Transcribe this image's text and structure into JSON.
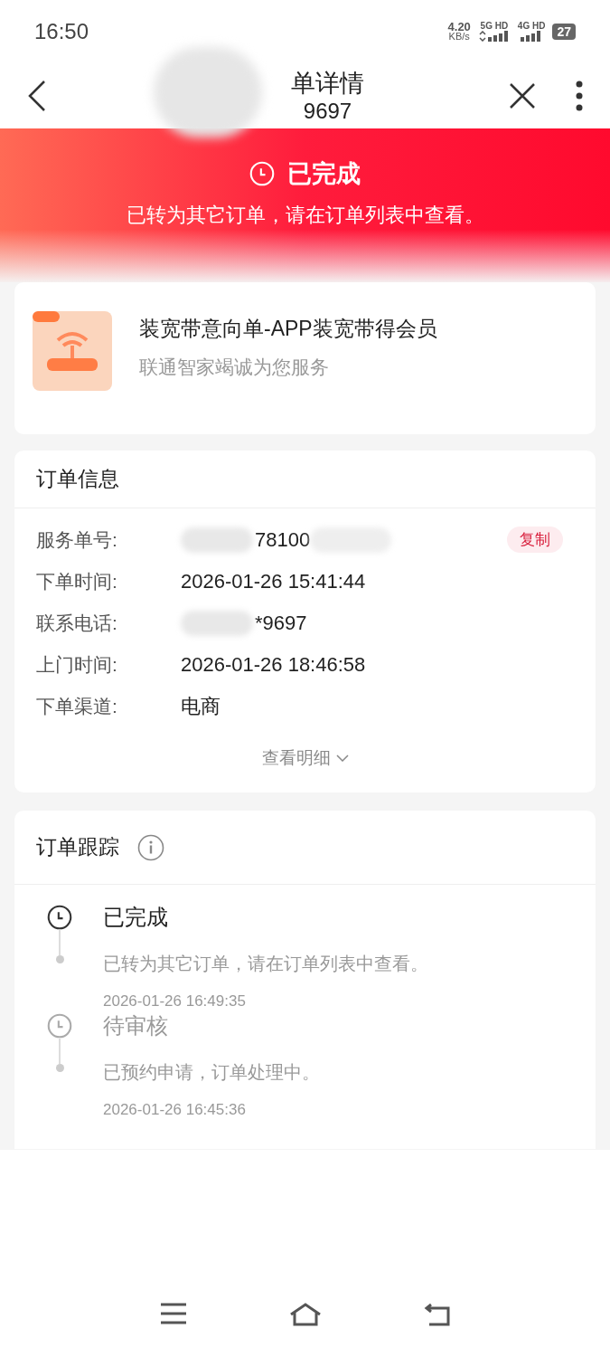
{
  "status_bar": {
    "time": "16:50",
    "speed": "4.20",
    "speed_unit": "KB/s",
    "sim1": "5G HD",
    "sim2": "4G HD",
    "battery": "27"
  },
  "nav": {
    "title": "单详情",
    "subtitle": "9697"
  },
  "banner": {
    "status": "已完成",
    "message": "已转为其它订单，请在订单列表中查看。"
  },
  "product": {
    "title": "装宽带意向单-APP装宽带得会员",
    "subtitle": "联通智家竭诚为您服务"
  },
  "order_info": {
    "heading": "订单信息",
    "rows": [
      {
        "label": "服务单号:",
        "value": "78100",
        "redacted": true,
        "action": "复制"
      },
      {
        "label": "下单时间:",
        "value": "2026-01-26 15:41:44",
        "redacted": false
      },
      {
        "label": "联系电话:",
        "value": "*9697",
        "redacted": true
      },
      {
        "label": "上门时间:",
        "value": "2026-01-26 18:46:58",
        "redacted": false
      },
      {
        "label": "下单渠道:",
        "value": "电商",
        "redacted": false
      }
    ],
    "more": "查看明细"
  },
  "tracking": {
    "heading": "订单跟踪",
    "events": [
      {
        "title": "已完成",
        "active": true,
        "detail": "已转为其它订单，请在订单列表中查看。",
        "time": "2026-01-26 16:49:35"
      },
      {
        "title": "待审核",
        "active": false,
        "detail": "已预约申请，订单处理中。",
        "time": "2026-01-26 16:45:36"
      }
    ]
  }
}
